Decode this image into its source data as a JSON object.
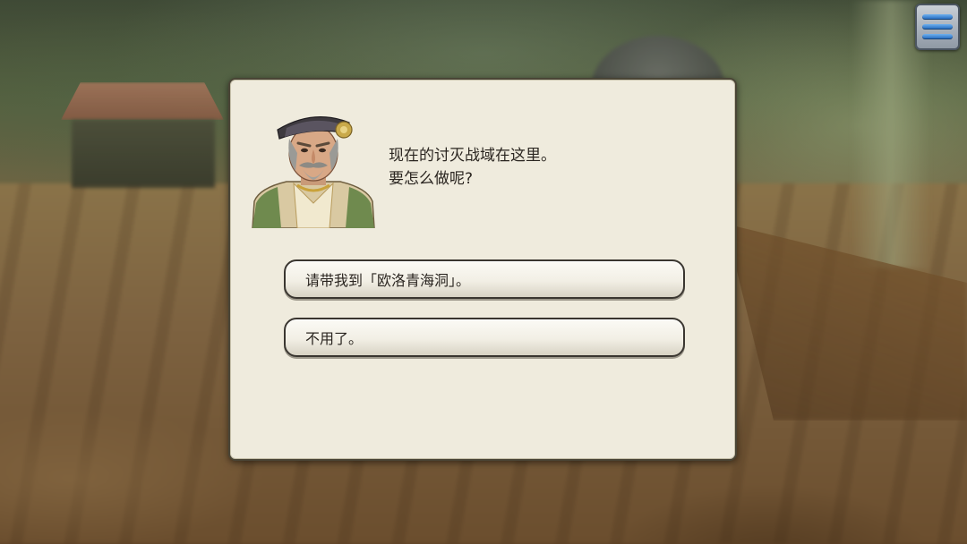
{
  "dialog": {
    "lines": [
      "现在的讨灭战域在这里。",
      "要怎么做呢?"
    ]
  },
  "choices": [
    {
      "label": "请带我到「欧洛青海洞」。"
    },
    {
      "label": "不用了。"
    }
  ],
  "icons": {
    "menu": "hamburger-menu-icon",
    "npc": "npc-portrait"
  },
  "colors": {
    "panel_bg": "#efebdd",
    "panel_border": "#4a4536",
    "menu_bar": "#1c63b8"
  }
}
